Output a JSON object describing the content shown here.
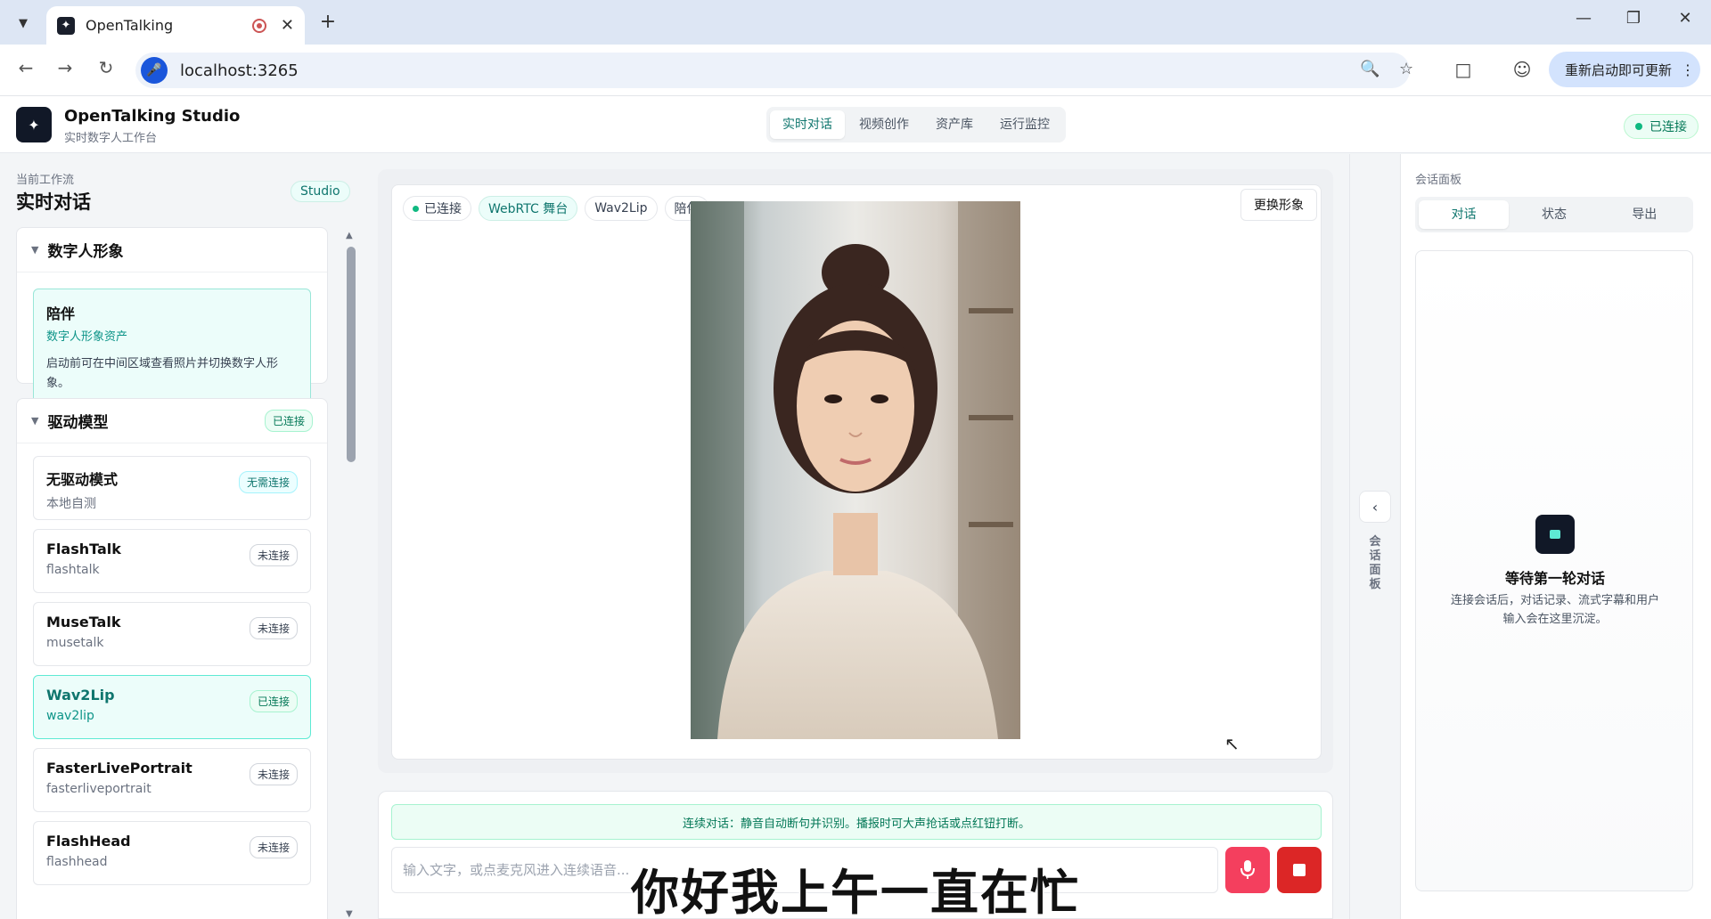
{
  "browser": {
    "tab_title": "OpenTalking",
    "url": "localhost:3265",
    "update_label": "重新启动即可更新"
  },
  "header": {
    "app_title": "OpenTalking Studio",
    "app_subtitle": "实时数字人工作台",
    "nav": [
      "实时对话",
      "视频创作",
      "资产库",
      "运行监控"
    ],
    "status": "已连接"
  },
  "sidebar": {
    "workflow_label": "当前工作流",
    "workflow_title": "实时对话",
    "studio_badge": "Studio",
    "avatar_panel": {
      "title": "数字人形象",
      "card": {
        "name": "陪伴",
        "kind": "数字人形象资产",
        "desc": "启动前可在中间区域查看照片并切换数字人形象。"
      }
    },
    "model_panel": {
      "title": "驱动模型",
      "status": "已连接",
      "models": [
        {
          "name": "无驱动模式",
          "id": "本地自测",
          "status": "无需连接"
        },
        {
          "name": "FlashTalk",
          "id": "flashtalk",
          "status": "未连接"
        },
        {
          "name": "MuseTalk",
          "id": "musetalk",
          "status": "未连接"
        },
        {
          "name": "Wav2Lip",
          "id": "wav2lip",
          "status": "已连接"
        },
        {
          "name": "FasterLivePortrait",
          "id": "fasterliveportrait",
          "status": "未连接"
        },
        {
          "name": "FlashHead",
          "id": "flashhead",
          "status": "未连接"
        }
      ]
    }
  },
  "stage": {
    "chips": [
      "已连接",
      "WebRTC 舞台",
      "Wav2Lip",
      "陪伴"
    ],
    "swap_label": "更换形象"
  },
  "composer": {
    "hint": "连续对话：静音自动断句并识别。播报时可大声抢话或点红钮打断。",
    "placeholder": "输入文字，或点麦克风进入连续语音...",
    "subtitle": "你好我上午一直在忙"
  },
  "rail": {
    "label": [
      "会",
      "话",
      "面",
      "板"
    ]
  },
  "right_panel": {
    "label": "会话面板",
    "tabs": [
      "对话",
      "状态",
      "导出"
    ],
    "empty_title": "等待第一轮对话",
    "empty_desc": "连接会话后，对话记录、流式字幕和用户输入会在这里沉淀。"
  },
  "colors": {
    "accent": "#0f766e",
    "connected": "#10b981",
    "mic": "#f43f5e",
    "stop": "#dc2626"
  }
}
